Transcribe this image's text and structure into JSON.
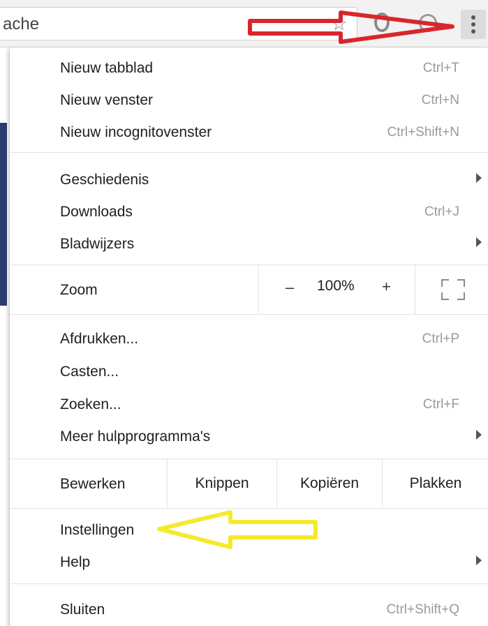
{
  "toolbar": {
    "omnibox_text": "ache",
    "icons": [
      "star-icon",
      "extension-icon",
      "account-icon",
      "menu-icon"
    ]
  },
  "menu": {
    "group1": [
      {
        "label": "Nieuw tabblad",
        "shortcut": "Ctrl+T"
      },
      {
        "label": "Nieuw venster",
        "shortcut": "Ctrl+N"
      },
      {
        "label": "Nieuw incognitovenster",
        "shortcut": "Ctrl+Shift+N"
      }
    ],
    "group2": [
      {
        "label": "Geschiedenis",
        "submenu": true
      },
      {
        "label": "Downloads",
        "shortcut": "Ctrl+J"
      },
      {
        "label": "Bladwijzers",
        "submenu": true
      }
    ],
    "zoom": {
      "label": "Zoom",
      "minus": "–",
      "value": "100%",
      "plus": "+"
    },
    "group3": [
      {
        "label": "Afdrukken...",
        "shortcut": "Ctrl+P"
      },
      {
        "label": "Casten..."
      },
      {
        "label": "Zoeken...",
        "shortcut": "Ctrl+F"
      },
      {
        "label": "Meer hulpprogramma's",
        "submenu": true
      }
    ],
    "edit": {
      "label": "Bewerken",
      "cut": "Knippen",
      "copy": "Kopiëren",
      "paste": "Plakken"
    },
    "group4": [
      {
        "label": "Instellingen"
      },
      {
        "label": "Help",
        "submenu": true
      }
    ],
    "exit": {
      "label": "Sluiten",
      "shortcut": "Ctrl+Shift+Q"
    }
  },
  "annotations": {
    "menu_arrow_color": "#d9262c",
    "settings_arrow_color": "#f5ea2a"
  }
}
